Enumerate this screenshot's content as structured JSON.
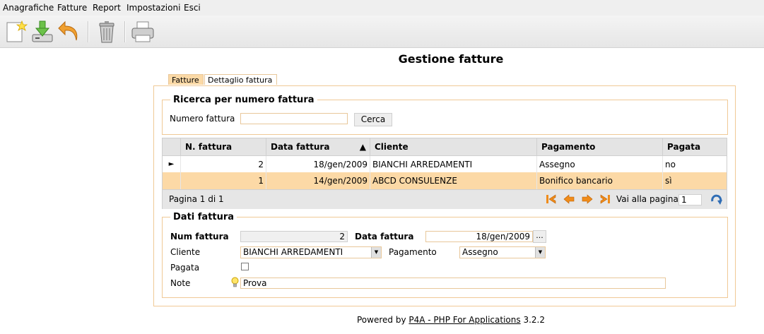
{
  "menu": {
    "items": [
      {
        "label": "Anagrafiche"
      },
      {
        "label": "Fatture"
      },
      {
        "label": "Report"
      },
      {
        "label": "Impostazioni"
      },
      {
        "label": "Esci"
      }
    ]
  },
  "toolbar": {
    "buttons": [
      "new-icon",
      "save-icon",
      "undo-icon",
      "delete-icon",
      "print-icon"
    ]
  },
  "page": {
    "title": "Gestione fatture"
  },
  "tabs": [
    {
      "label": "Fatture",
      "active": true
    },
    {
      "label": "Dettaglio fattura",
      "active": false
    }
  ],
  "search": {
    "legend": "Ricerca per numero fattura",
    "label": "Numero fattura",
    "value": "",
    "button": "Cerca"
  },
  "grid": {
    "columns": [
      "N. fattura",
      "Data fattura",
      "Cliente",
      "Pagamento",
      "Pagata"
    ],
    "sort_indicator": "▲",
    "rows": [
      {
        "numero": "2",
        "data": "18/gen/2009",
        "cliente": "BIANCHI ARREDAMENTI",
        "pagamento": "Assegno",
        "pagata": "no",
        "current": true
      },
      {
        "numero": "1",
        "data": "14/gen/2009",
        "cliente": "ABCD CONSULENZE",
        "pagamento": "Bonifico bancario",
        "pagata": "sì",
        "current": false
      }
    ],
    "current_marker": "►",
    "pager": {
      "text": "Pagina 1 di 1",
      "goto_label": "Vai alla pagina",
      "goto_value": "1"
    }
  },
  "details": {
    "legend": "Dati fattura",
    "num_label": "Num fattura",
    "num_value": "2",
    "date_label": "Data fattura",
    "date_value": "18/gen/2009",
    "date_button": "...",
    "cliente_label": "Cliente",
    "cliente_value": "BIANCHI ARREDAMENTI",
    "pagamento_label": "Pagamento",
    "pagamento_value": "Assegno",
    "pagata_label": "Pagata",
    "note_label": "Note",
    "note_value": "Prova"
  },
  "footer": {
    "prefix": "Powered by",
    "link": "P4A - PHP For Applications",
    "version": "3.2.2"
  }
}
